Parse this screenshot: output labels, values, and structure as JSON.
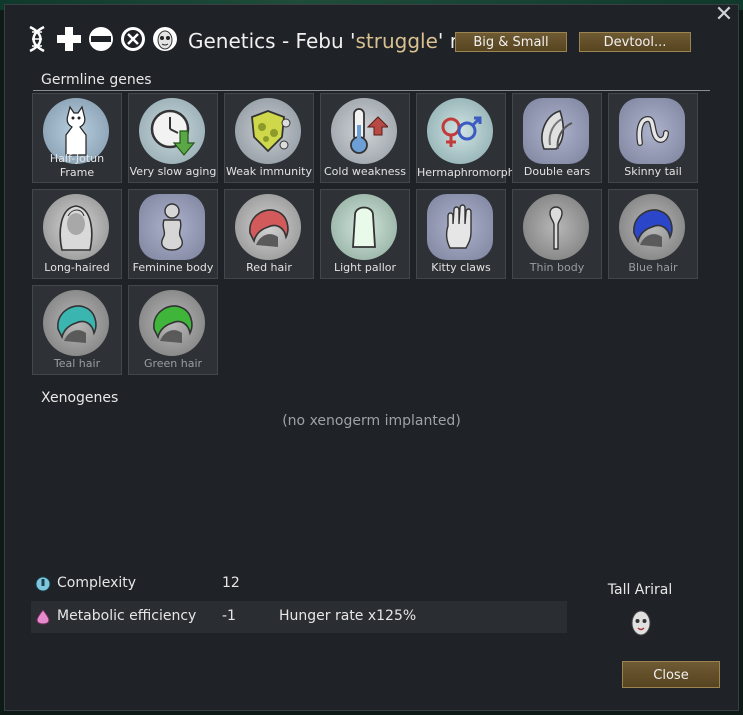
{
  "window": {
    "title_prefix": "Genetics - Febu '",
    "title_highlight": "struggle",
    "title_suffix": "' n",
    "close_glyph": "✕"
  },
  "header_icons": [
    "dna-icon",
    "add-icon",
    "remove-icon",
    "clear-icon",
    "xenotype-icon"
  ],
  "buttons": {
    "big_small": "Big & Small",
    "devtool": "Devtool...",
    "close": "Close"
  },
  "germline": {
    "heading": "Germline genes",
    "genes": [
      {
        "label": "Half-Jotun Frame",
        "icon": "jotun-icon",
        "active": true
      },
      {
        "label": "Very slow aging",
        "icon": "clock-icon",
        "active": true
      },
      {
        "label": "Weak immunity",
        "icon": "immunity-icon",
        "active": true
      },
      {
        "label": "Cold weakness",
        "icon": "thermometer-icon",
        "active": true
      },
      {
        "label": "Hermaphromorph",
        "icon": "gender-icon",
        "active": true
      },
      {
        "label": "Double ears",
        "icon": "ears-icon",
        "active": true
      },
      {
        "label": "Skinny tail",
        "icon": "tail-icon",
        "active": true
      },
      {
        "label": "Long-haired",
        "icon": "long-hair-icon",
        "active": true
      },
      {
        "label": "Feminine body",
        "icon": "feminine-body-icon",
        "active": true
      },
      {
        "label": "Red hair",
        "icon": "hair-icon",
        "active": true,
        "hair_color": "#d25a5a"
      },
      {
        "label": "Light pallor",
        "icon": "pallor-icon",
        "active": true
      },
      {
        "label": "Kitty claws",
        "icon": "claws-icon",
        "active": true
      },
      {
        "label": "Thin body",
        "icon": "thin-body-icon",
        "active": false
      },
      {
        "label": "Blue hair",
        "icon": "hair-icon",
        "active": false,
        "hair_color": "#2b46c8"
      },
      {
        "label": "Teal hair",
        "icon": "hair-icon",
        "active": false,
        "hair_color": "#3ab5b0"
      },
      {
        "label": "Green hair",
        "icon": "hair-icon",
        "active": false,
        "hair_color": "#3fb53a"
      }
    ]
  },
  "xenogenes": {
    "heading": "Xenogenes",
    "empty_text": "(no xenogerm implanted)"
  },
  "stats": [
    {
      "name": "Complexity",
      "value": "12",
      "desc": "",
      "icon": "complexity-icon",
      "color": "#7fc7df"
    },
    {
      "name": "Metabolic efficiency",
      "value": "-1",
      "desc": "Hunger rate x125%",
      "icon": "metabolism-icon",
      "color": "#e58acb"
    }
  ],
  "xenotype": {
    "name": "Tall Ariral",
    "icon": "xenotype-face-icon"
  }
}
